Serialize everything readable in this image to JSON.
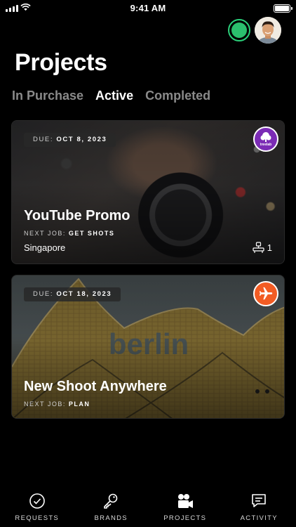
{
  "status_bar": {
    "time": "9:41 AM"
  },
  "header": {
    "title": "Projects"
  },
  "tabs": [
    {
      "label": "In Purchase",
      "active": false
    },
    {
      "label": "Active",
      "active": true
    },
    {
      "label": "Completed",
      "active": false
    }
  ],
  "projects": [
    {
      "due_label": "DUE:",
      "due_date": "OCT 8, 2023",
      "title": "YouTube Promo",
      "next_job_label": "NEXT JOB:",
      "next_job": "GET SHOTS",
      "location": "Singapore",
      "crew_count": "1",
      "brand_icon": "treelab-logo",
      "brand_text": "treelab",
      "brand_color": "#7b2bb5"
    },
    {
      "due_label": "DUE:",
      "due_date": "OCT 18, 2023",
      "title": "New Shoot Anywhere",
      "next_job_label": "NEXT JOB:",
      "next_job": "PLAN",
      "brand_icon": "airplane-icon",
      "brand_color": "#f25c24",
      "image_text": "berlin"
    }
  ],
  "tab_bar": [
    {
      "label": "REQUESTS",
      "icon": "check-circle-icon"
    },
    {
      "label": "BRANDS",
      "icon": "key-icon"
    },
    {
      "label": "PROJECTS",
      "icon": "video-camera-icon"
    },
    {
      "label": "ACTIVITY",
      "icon": "chat-icon"
    }
  ],
  "colors": {
    "online": "#2bd07a",
    "active_tab": "#ffffff",
    "inactive_tab": "#8a8a8a"
  }
}
